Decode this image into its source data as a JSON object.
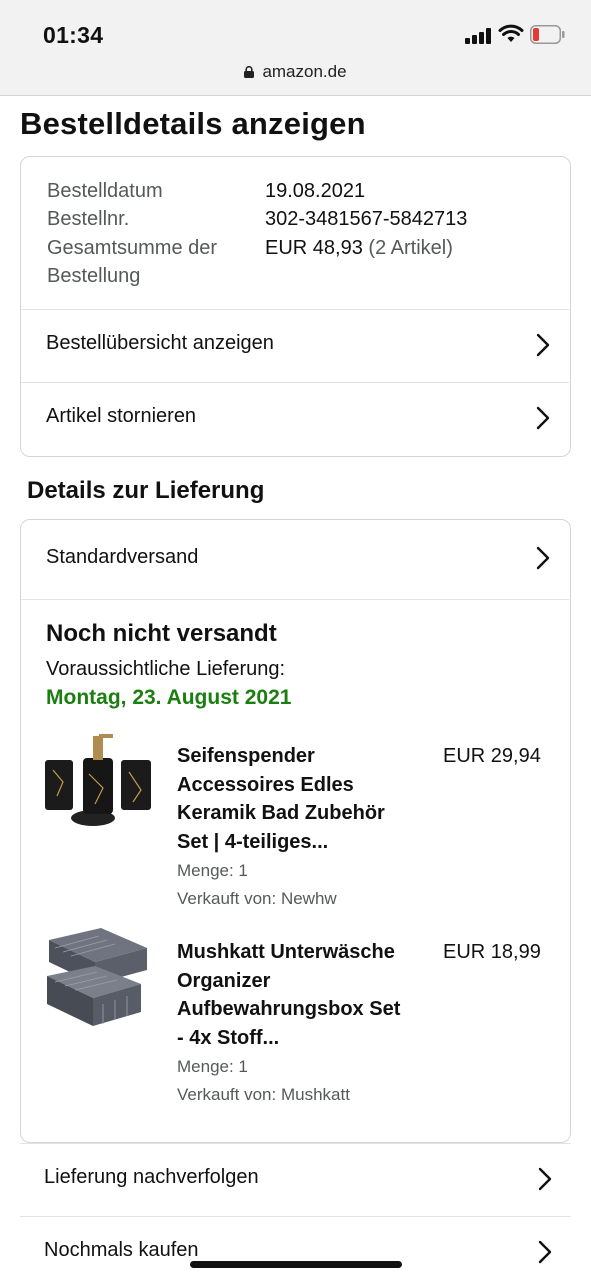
{
  "status_bar": {
    "time": "01:34",
    "url": "amazon.de"
  },
  "page_title": "Bestelldetails anzeigen",
  "order_summary": {
    "date_label": "Bestelldatum",
    "date_value": "19.08.2021",
    "number_label": "Bestellnr.",
    "number_value": "302-3481567-5842713",
    "total_label_line1": "Gesamtsumme der",
    "total_label_line2": "Bestellung",
    "total_value": "EUR 48,93",
    "total_count": "(2 Artikel)",
    "actions": [
      "Bestellübersicht anzeigen",
      "Artikel stornieren"
    ]
  },
  "delivery": {
    "section_title": "Details zur Lieferung",
    "method": "Standardversand",
    "status": "Noch nicht versandt",
    "expected_label": "Voraussichtliche Lieferung:",
    "expected_date": "Montag, 23. August 2021",
    "items": [
      {
        "name_lines": [
          "Seifenspender",
          "Accessoires Edles",
          "Keramik Bad Zubehör",
          "Set | 4-teiliges..."
        ],
        "price": "EUR 29,94",
        "quantity": "Menge: 1",
        "seller": "Verkauft von: Newhw",
        "icon": "bathroom-set-thumbnail"
      },
      {
        "name_lines": [
          "Mushkatt Unterwäsche",
          "Organizer",
          "Aufbewahrungsbox Set",
          "- 4x Stoff..."
        ],
        "price": "EUR 18,99",
        "quantity": "Menge: 1",
        "seller": "Verkauft von: Mushkatt",
        "icon": "organizer-box-thumbnail"
      }
    ]
  },
  "bottom_actions": [
    "Lieferung nachverfolgen",
    "Nochmals kaufen"
  ],
  "colors": {
    "green_date": "#1a7f10",
    "muted": "#565959",
    "border": "#d5d5d5",
    "battery_low": "#e53935"
  }
}
